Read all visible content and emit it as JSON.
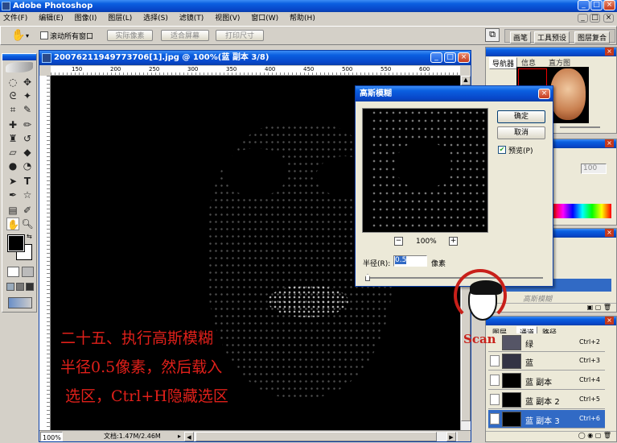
{
  "app": {
    "title": "Adobe Photoshop"
  },
  "menu": [
    "文件(F)",
    "编辑(E)",
    "图像(I)",
    "图层(L)",
    "选择(S)",
    "滤镜(T)",
    "视图(V)",
    "窗口(W)",
    "帮助(H)"
  ],
  "options": {
    "scroll_all": "滚动所有窗口",
    "actual_pixels": "实际像素",
    "fit_screen": "适合屏幕",
    "print_size": "打印尺寸"
  },
  "dock_tabs": [
    "画笔",
    "工具预设",
    "图层复合"
  ],
  "document": {
    "title": "20076211949773706[1].jpg @ 100%(蓝 副本 3/8)",
    "ruler_labels": [
      "150",
      "200",
      "250",
      "300",
      "350",
      "400",
      "450",
      "500",
      "550",
      "600",
      "650",
      "700"
    ],
    "zoom": "100%",
    "doc_size": "文档:1.47M/2.46M"
  },
  "caption": [
    "二十五、执行高斯模糊",
    "半径0.5像素，然后载入",
    "选区，Ctrl+H隐藏选区"
  ],
  "gauss_dialog": {
    "title": "高斯模糊",
    "ok": "确定",
    "cancel": "取消",
    "preview_label": "预览(P)",
    "preview_checked": true,
    "zoom": "100%",
    "zoom_out": "−",
    "zoom_in": "+",
    "radius_label": "半径(R):",
    "radius_value": "0.5",
    "unit": "像素"
  },
  "navigator": {
    "tabs": [
      "导航器",
      "信息",
      "直方图"
    ]
  },
  "layers_panel": {
    "opacity": "100",
    "history_item": "高斯模糊"
  },
  "channels_panel": {
    "tabs": [
      "图层",
      "通道",
      "路径"
    ],
    "channels": [
      {
        "name": "绿",
        "shortcut": "Ctrl+2"
      },
      {
        "name": "蓝",
        "shortcut": "Ctrl+3"
      },
      {
        "name": "蓝 副本",
        "shortcut": "Ctrl+4"
      },
      {
        "name": "蓝 副本 2",
        "shortcut": "Ctrl+5"
      },
      {
        "name": "蓝 副本 3",
        "shortcut": "Ctrl+6"
      }
    ]
  },
  "watermark": "Scan"
}
